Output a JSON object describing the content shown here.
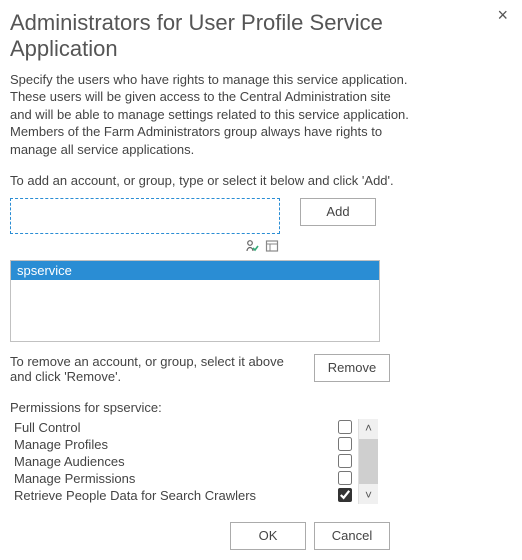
{
  "dialog": {
    "title": "Administrators for User Profile Service Application",
    "close_label": "×",
    "description": "Specify the users who have rights to manage this service application. These users will be given access to the Central Administration site and will be able to manage settings related to this service application. Members of the Farm Administrators group always have rights to manage all service applications.",
    "add_instruction": "To add an account, or group, type or select it below and click 'Add'.",
    "picker_value": "",
    "add_button": "Add",
    "members": [
      "spservice"
    ],
    "remove_instruction": "To remove an account, or group, select it above and click 'Remove'.",
    "remove_button": "Remove",
    "permissions_label": "Permissions for spservice:",
    "permissions": [
      {
        "label": "Full Control",
        "checked": false
      },
      {
        "label": "Manage Profiles",
        "checked": false
      },
      {
        "label": "Manage Audiences",
        "checked": false
      },
      {
        "label": "Manage Permissions",
        "checked": false
      },
      {
        "label": "Retrieve People Data for Search Crawlers",
        "checked": true
      }
    ],
    "ok_button": "OK",
    "cancel_button": "Cancel"
  }
}
